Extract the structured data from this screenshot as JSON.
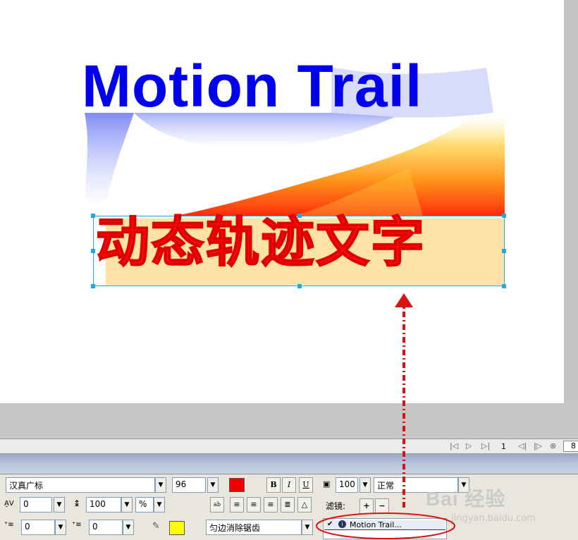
{
  "canvas": {
    "title_en": "Motion Trail",
    "title_cn": "动态轨迹文字",
    "colors": {
      "title_en": "#0000ee",
      "title_cn": "#ff1010",
      "selection": "#22aadd",
      "annotation": "#dd1111"
    }
  },
  "timeline": {
    "controls": [
      "first-frame-icon",
      "play-icon",
      "last-frame-icon",
      "prev-icon",
      "next-icon",
      "loop-icon"
    ],
    "frame": "1",
    "zoom": "8"
  },
  "properties": {
    "font_family": "汉真广标",
    "font_size": "96",
    "text_color": "#ee0000",
    "bold": "B",
    "italic": "I",
    "underline": "U",
    "letter_spacing": "0",
    "line_spacing": "100",
    "line_spacing_unit": "%",
    "indent": "0",
    "indent_after": "0",
    "highlight_color": "#ffff00",
    "antialias": "匀边消除锯齿",
    "opacity": "100",
    "blend_mode": "正常",
    "filters_label": "滤镜:",
    "add_filter": "+",
    "remove_filter": "−",
    "filter_item": "Motion Trail..."
  },
  "watermark": {
    "brand": "Bai 经验",
    "url": "jingyan.baidu.com"
  }
}
